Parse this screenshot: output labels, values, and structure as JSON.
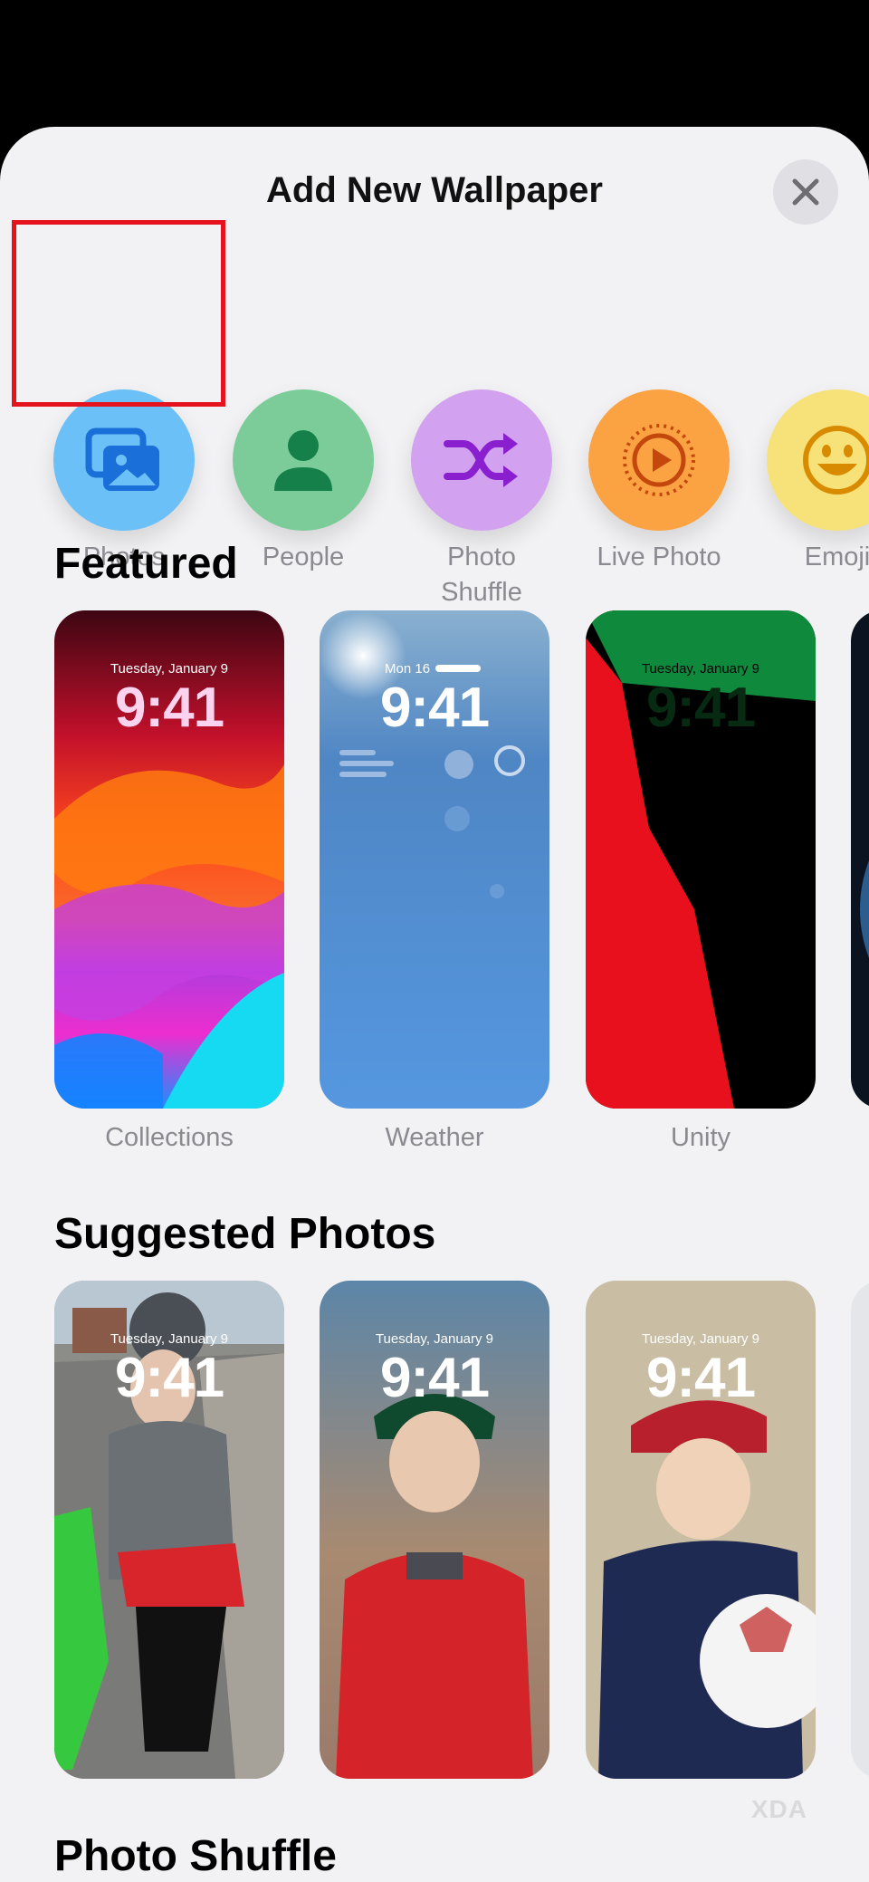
{
  "header": {
    "title": "Add New Wallpaper"
  },
  "wallpaper_types": [
    {
      "label": "Photos",
      "color": "#6bc0f8",
      "icon": "photos-icon"
    },
    {
      "label": "People",
      "color": "#7ccc9a",
      "icon": "person-icon"
    },
    {
      "label": "Photo\nShuffle",
      "color": "#d2a2f0",
      "icon": "shuffle-icon"
    },
    {
      "label": "Live Photo",
      "color": "#fba343",
      "icon": "live-photo-icon"
    },
    {
      "label": "Emoji",
      "color": "#f7e27a",
      "icon": "emoji-icon"
    }
  ],
  "featured": {
    "title": "Featured",
    "cards": [
      {
        "label": "Collections",
        "date": "Tuesday, January 9",
        "time": "9:41"
      },
      {
        "label": "Weather",
        "date": "Mon 16",
        "time": "9:41"
      },
      {
        "label": "Unity",
        "date": "Tuesday, January 9",
        "time": "9:41"
      }
    ]
  },
  "suggested": {
    "title": "Suggested Photos",
    "cards": [
      {
        "date": "Tuesday, January 9",
        "time": "9:41"
      },
      {
        "date": "Tuesday, January 9",
        "time": "9:41"
      },
      {
        "date": "Tuesday, January 9",
        "time": "9:41"
      }
    ]
  },
  "photo_shuffle": {
    "title": "Photo Shuffle"
  },
  "watermark": "XDA"
}
